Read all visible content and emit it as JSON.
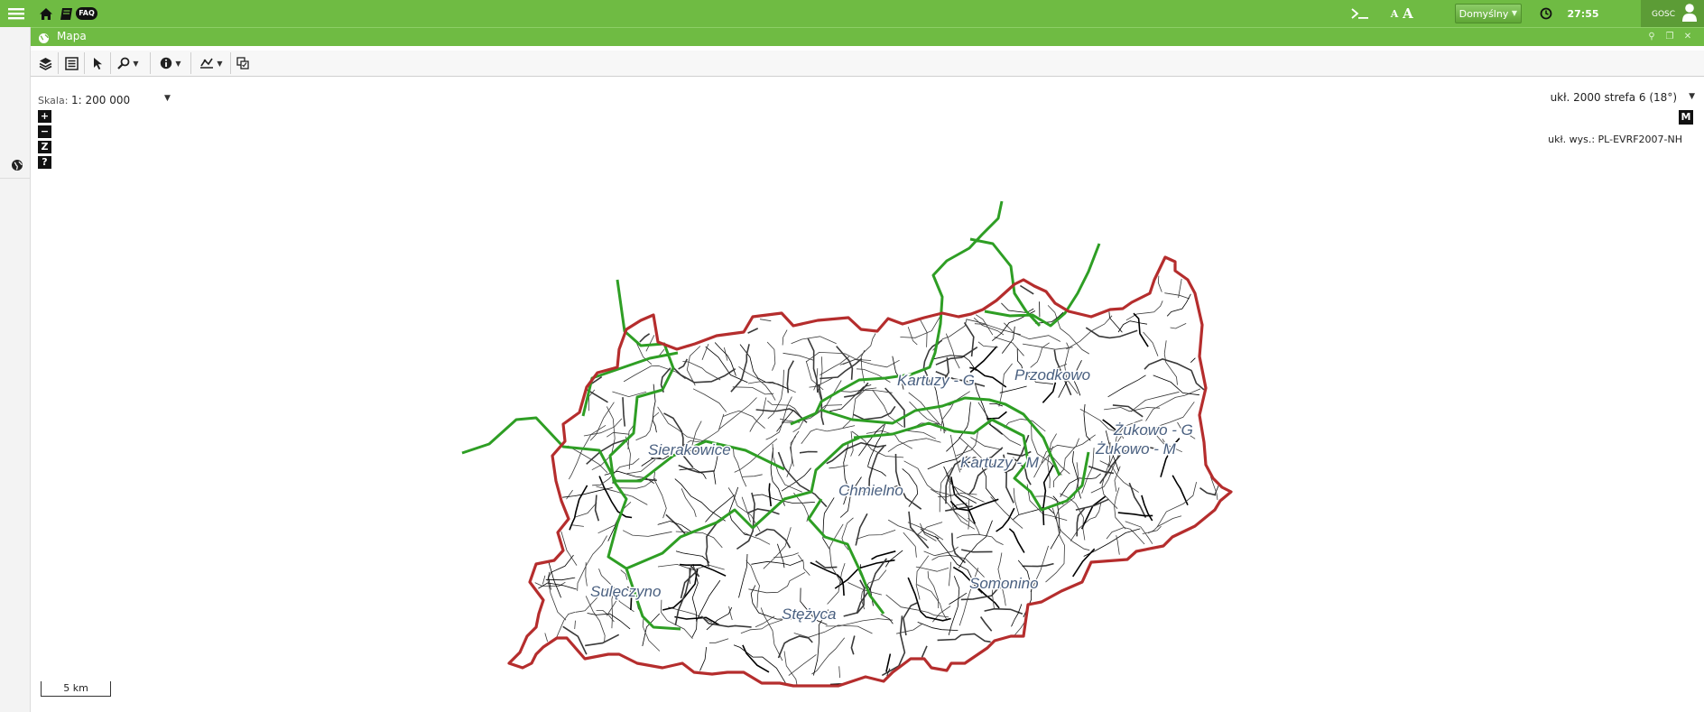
{
  "topbar": {
    "faq_label": "FAQ",
    "profile": "Domyślny",
    "timer": "27:55",
    "user": "GOSC",
    "font_small": "A",
    "font_large": "A"
  },
  "panel": {
    "title": "Mapa"
  },
  "map": {
    "scale_label": "Skala:",
    "scale_value": "1: 200 000",
    "crs": "ukł. 2000 strefa 6 (18°)",
    "height_system": "ukł. wys.: PL-EVRF2007-NH",
    "m_button": "M",
    "zoom": {
      "in": "+",
      "out": "−",
      "z": "Z",
      "help": "?"
    },
    "scalebar": "5 km",
    "gminy": [
      "Kartuzy - G",
      "Przodkowo",
      "Sierakowice",
      "Kartuzy - M",
      "Żukowo - G",
      "Żukowo - M",
      "Chmielno",
      "Sulęczyno",
      "Somonino",
      "Stężyca"
    ],
    "colors": {
      "outer_border": "#b52d2d",
      "gmina_border": "#2e9e24",
      "roads": "#222222"
    }
  },
  "icons": [
    "menu-icon",
    "home-icon",
    "book-icon",
    "terminal-icon",
    "clock-icon",
    "user-icon",
    "globe-icon",
    "layers-icon",
    "legend-icon",
    "pointer-icon",
    "search-icon",
    "info-icon",
    "measure-icon",
    "compare-icon"
  ]
}
